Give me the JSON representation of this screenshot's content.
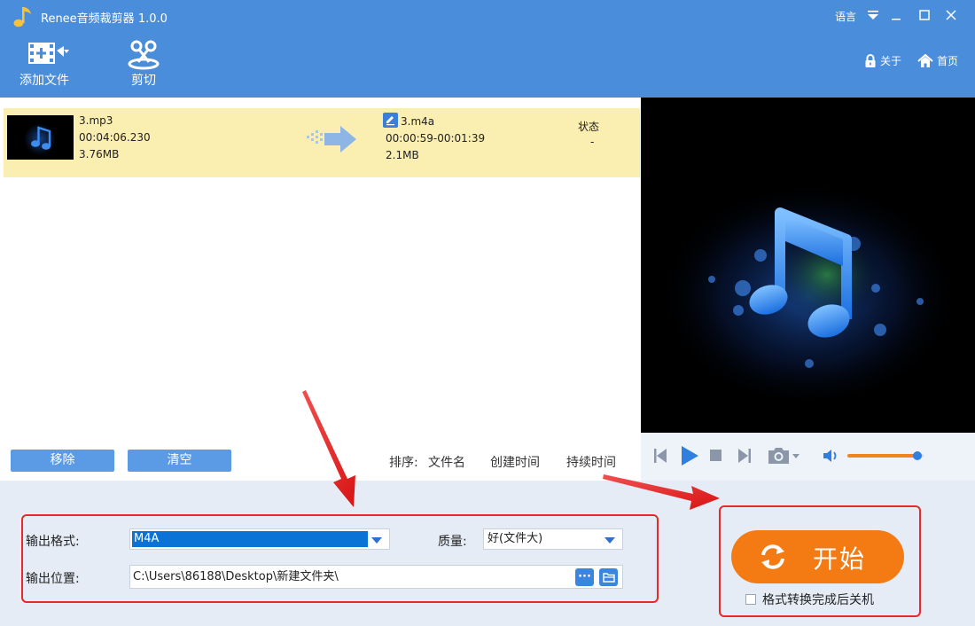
{
  "app": {
    "title": "Renee音频裁剪器 1.0.0",
    "language_label": "语言"
  },
  "toolbar": {
    "add_file_label": "添加文件",
    "cut_label": "剪切",
    "about_label": "关于",
    "home_label": "首页"
  },
  "file_list": {
    "rows": [
      {
        "source_name": "3.mp3",
        "source_duration": "00:04:06.230",
        "source_size": "3.76MB",
        "output_name": "3.m4a",
        "output_range": "00:00:59-00:01:39",
        "output_size": "2.1MB",
        "status_header": "状态",
        "status_value": "-"
      }
    ],
    "remove_label": "移除",
    "clear_label": "清空",
    "sort_label": "排序:",
    "sort_by_name": "文件名",
    "sort_by_created": "创建时间",
    "sort_by_duration": "持续时间"
  },
  "player": {
    "volume_level": 0.92
  },
  "output": {
    "format_label": "输出格式:",
    "format_value": "M4A",
    "quality_label": "质量:",
    "quality_value": "好(文件大)",
    "location_label": "输出位置:",
    "location_value": "C:\\Users\\86188\\Desktop\\新建文件夹\\",
    "browse_dots": "···"
  },
  "start": {
    "label": "开始",
    "shutdown_label": "格式转换完成后关机",
    "shutdown_checked": false
  },
  "colors": {
    "header_blue": "#4a8ddb",
    "row_highlight": "#fbeeb1",
    "start_orange": "#f47b13",
    "annotation_red": "#e8282a"
  }
}
